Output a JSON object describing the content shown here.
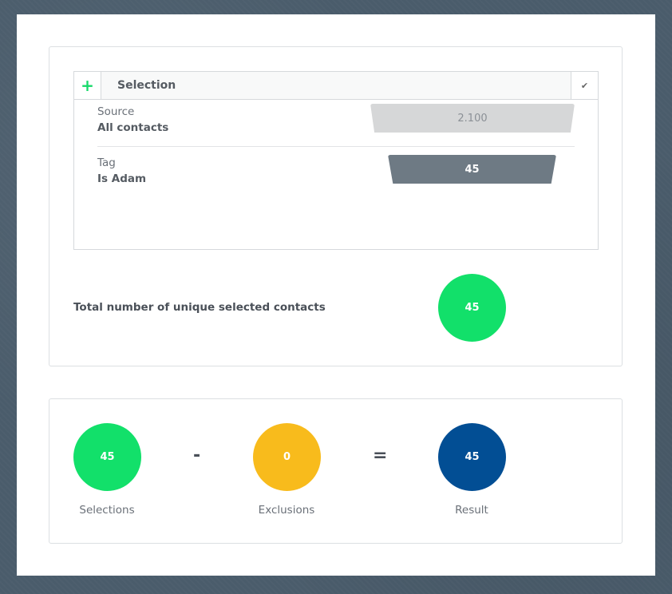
{
  "selection_panel": {
    "title": "Selection",
    "plus_icon": "plus-icon",
    "check_icon": "checkmark-icon",
    "rows": [
      {
        "label": "Source",
        "value": "All contacts",
        "count": "2.100"
      },
      {
        "label": "Tag",
        "value": "Is Adam",
        "count": "45"
      }
    ]
  },
  "total": {
    "label": "Total number of unique selected contacts",
    "value": "45"
  },
  "summary": {
    "selections": {
      "value": "45",
      "caption": "Selections"
    },
    "minus": "-",
    "exclusions": {
      "value": "0",
      "caption": "Exclusions"
    },
    "equals": "=",
    "result": {
      "value": "45",
      "caption": "Result"
    }
  },
  "colors": {
    "green": "#12e06a",
    "yellow": "#f8bb1c",
    "blue": "#024e94",
    "grey_funnel": "#6e7a84"
  }
}
